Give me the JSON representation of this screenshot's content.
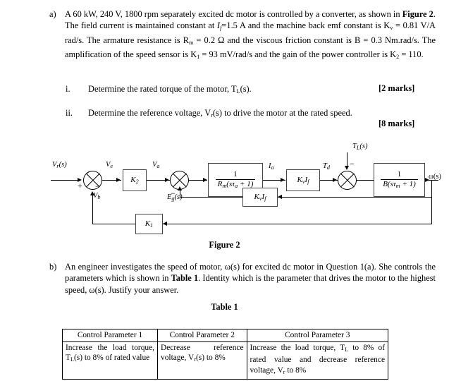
{
  "question_a": {
    "label": "a)",
    "text_parts": [
      {
        "t": "A 60 kW, 240 V, 1800 rpm separately excited dc motor is controlled by a converter, as shown in "
      },
      {
        "t": "Figure 2",
        "bold": true
      },
      {
        "t": ". The field current is maintained constant at I"
      },
      {
        "t": "f",
        "sub": true
      },
      {
        "t": "=1.5 A and the machine back emf constant is K"
      },
      {
        "t": "v",
        "sub": true
      },
      {
        "t": " = 0.81 V/A rad/s. The armature resistance is R"
      },
      {
        "t": "m",
        "sub": true
      },
      {
        "t": " = 0.2 Ω and the viscous friction constant is B = 0.3 Nm.rad/s. The amplification of the speed sensor is K"
      },
      {
        "t": "1",
        "sub": true
      },
      {
        "t": " = 93 mV/rad/s and the gain of the power controller is K"
      },
      {
        "t": "2",
        "sub": true
      },
      {
        "t": " = 110."
      }
    ],
    "full_text": "A 60 kW, 240 V, 1800 rpm separately excited dc motor is controlled by a converter, as shown in Figure 2. The field current is maintained constant at If=1.5 A and the machine back emf constant is Kv = 0.81 V/A rad/s. The armature resistance is Rm = 0.2 Ω and the viscous friction constant is B = 0.3 Nm.rad/s. The amplification of the speed sensor is K1 = 93 mV/rad/s and the gain of the power controller is K2 = 110.",
    "parameters": {
      "power_kw": "60 kW",
      "voltage_v": "240 V",
      "speed_rpm": "1800 rpm",
      "field_current": "If=1.5 A",
      "back_emf_constant": "Kv = 0.81 V/A rad/s",
      "armature_resistance": "Rm = 0.2 Ω",
      "viscous_friction": "B = 0.3 Nm.rad/s",
      "speed_sensor_gain": "K1 = 93 mV/rad/s",
      "power_controller_gain": "K2 = 110"
    },
    "sub_items": [
      {
        "numeral": "i.",
        "text": "Determine the rated torque of the motor, T",
        "text_sub": "L",
        "text_after": "(s).",
        "marks": "[2 marks]"
      },
      {
        "numeral": "ii.",
        "text": "Determine the reference voltage, V",
        "text_sub": "r",
        "text_after": "(s) to drive the motor at the rated speed.",
        "marks": "[8 marks]"
      }
    ]
  },
  "question_b": {
    "label": "b)",
    "text_before": "An engineer investigates the speed of motor, ω(s) for excited dc motor in Question 1(a). She controls the parameters which is shown in ",
    "bold_ref": "Table 1",
    "text_after": ". Identity which is the parameter that drives the motor to the highest speed, ω(s). Justify your answer.",
    "full_text": "An engineer investigates the speed of motor, ω(s) for excited dc motor in Question 1(a). She controls the parameters which is shown in Table 1. Identity which is the parameter that drives the motor to the highest speed, ω(s). Justify your answer."
  },
  "figure": {
    "caption": "Figure 2",
    "signals": {
      "input": "V",
      "input_sub": "r",
      "input_after": "(s)",
      "error": "V",
      "error_sub": "e",
      "feedback_voltage": "V",
      "feedback_voltage_sub": "b",
      "armature_voltage": "V",
      "armature_voltage_sub": "a",
      "back_emf": "E",
      "back_emf_sub": "g",
      "back_emf_after": "(s)",
      "armature_current": "I",
      "armature_current_sub": "a",
      "developed_torque": "T",
      "developed_torque_sub": "d",
      "load_torque": "T",
      "load_torque_sub": "L",
      "load_torque_after": "(s)",
      "output": "ω(s)"
    },
    "blocks": {
      "controller_gain": "K",
      "controller_gain_sub": "2",
      "armature_num": "1",
      "armature_den_a": "R",
      "armature_den_a_sub": "m",
      "armature_den_b": "(sτ",
      "armature_den_b_sub": "a",
      "armature_den_c": " + 1)",
      "torque_const": "K",
      "torque_const_sub1": "v",
      "torque_const_2": "I",
      "torque_const_sub2": "f",
      "mech_num": "1",
      "mech_den_a": "B(sτ",
      "mech_den_a_sub": "m",
      "mech_den_b": " + 1)",
      "emf_fb": "K",
      "emf_fb_sub1": "v",
      "emf_fb_2": "I",
      "emf_fb_sub2": "f",
      "sensor_gain": "K",
      "sensor_gain_sub": "1"
    },
    "signs": {
      "sum1_plus": "+",
      "sum1_minus": "−",
      "sum2_minus": "−",
      "sum3_minus": "−"
    }
  },
  "table": {
    "caption": "Table 1",
    "headers": [
      "Control Parameter 1",
      "Control Parameter 2",
      "Control Parameter  3"
    ],
    "rows": [
      [
        {
          "pre": "Increase the load torque, T",
          "sub": "L",
          "post": "(s) to 8% of rated value",
          "full": "Increase the load torque, TL(s) to 8% of rated value"
        },
        {
          "pre": "Decrease reference voltage, V",
          "sub": "r",
          "post": "(s) to 8%",
          "full": "Decrease reference voltage, Vr(s) to 8%"
        },
        {
          "pre": "Increase the load torque, T",
          "sub": "L",
          "post": " to 8% of rated value and decrease reference voltage, V",
          "sub2": "r",
          "post2": " to 8%",
          "full": "Increase the load torque, TL to 8% of rated value and decrease reference voltage, Vr to 8%"
        }
      ]
    ]
  }
}
